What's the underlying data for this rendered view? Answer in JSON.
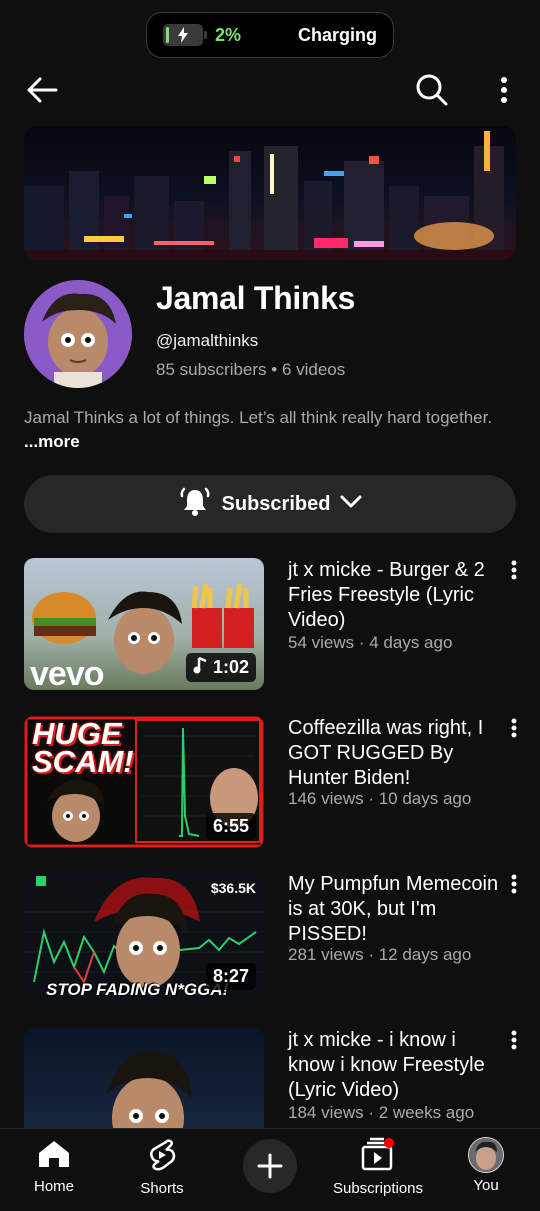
{
  "status": {
    "battery_percent": "2%",
    "charging_label": "Charging"
  },
  "topbar": {
    "back_icon": "back-arrow-icon",
    "search_icon": "search-icon",
    "menu_icon": "more-vert-icon"
  },
  "channel": {
    "name": "Jamal Thinks",
    "handle": "@jamalthinks",
    "stats": "85 subscribers • 6 videos",
    "description": "Jamal Thinks a lot of things. Let’s all think really hard together.",
    "more_label": "...more"
  },
  "subscribe": {
    "label": "Subscribed",
    "bell_icon": "bell-icon",
    "dropdown_icon": "chevron-down-icon"
  },
  "videos": [
    {
      "title": "jt x micke - Burger & 2 Fries Freestyle (Lyric Video)",
      "meta": "54 views · 4 days ago",
      "duration": "1:02",
      "thumb_text": "vevo"
    },
    {
      "title": "Coffeezilla was right, I GOT RUGGED By Hunter Biden!",
      "meta": "146 views · 10 days ago",
      "duration": "6:55",
      "thumb_text": "HUGE SCAM!"
    },
    {
      "title": "My Pumpfun Memecoin is at 30K, but I'm PISSED!",
      "meta": "281 views · 12 days ago",
      "duration": "8:27",
      "thumb_text": "STOP FADING N*GGA!",
      "thumb_value": "$36.5K"
    },
    {
      "title": "jt x micke - i know i know i know Freestyle (Lyric Video)",
      "meta": "184 views · 2 weeks ago",
      "duration": ""
    }
  ],
  "nav": {
    "home": "Home",
    "shorts": "Shorts",
    "subscriptions": "Subscriptions",
    "you": "You"
  },
  "colors": {
    "accent_green": "#7be36b",
    "background": "#0f0f0f",
    "notification_dot": "#ff0000"
  }
}
